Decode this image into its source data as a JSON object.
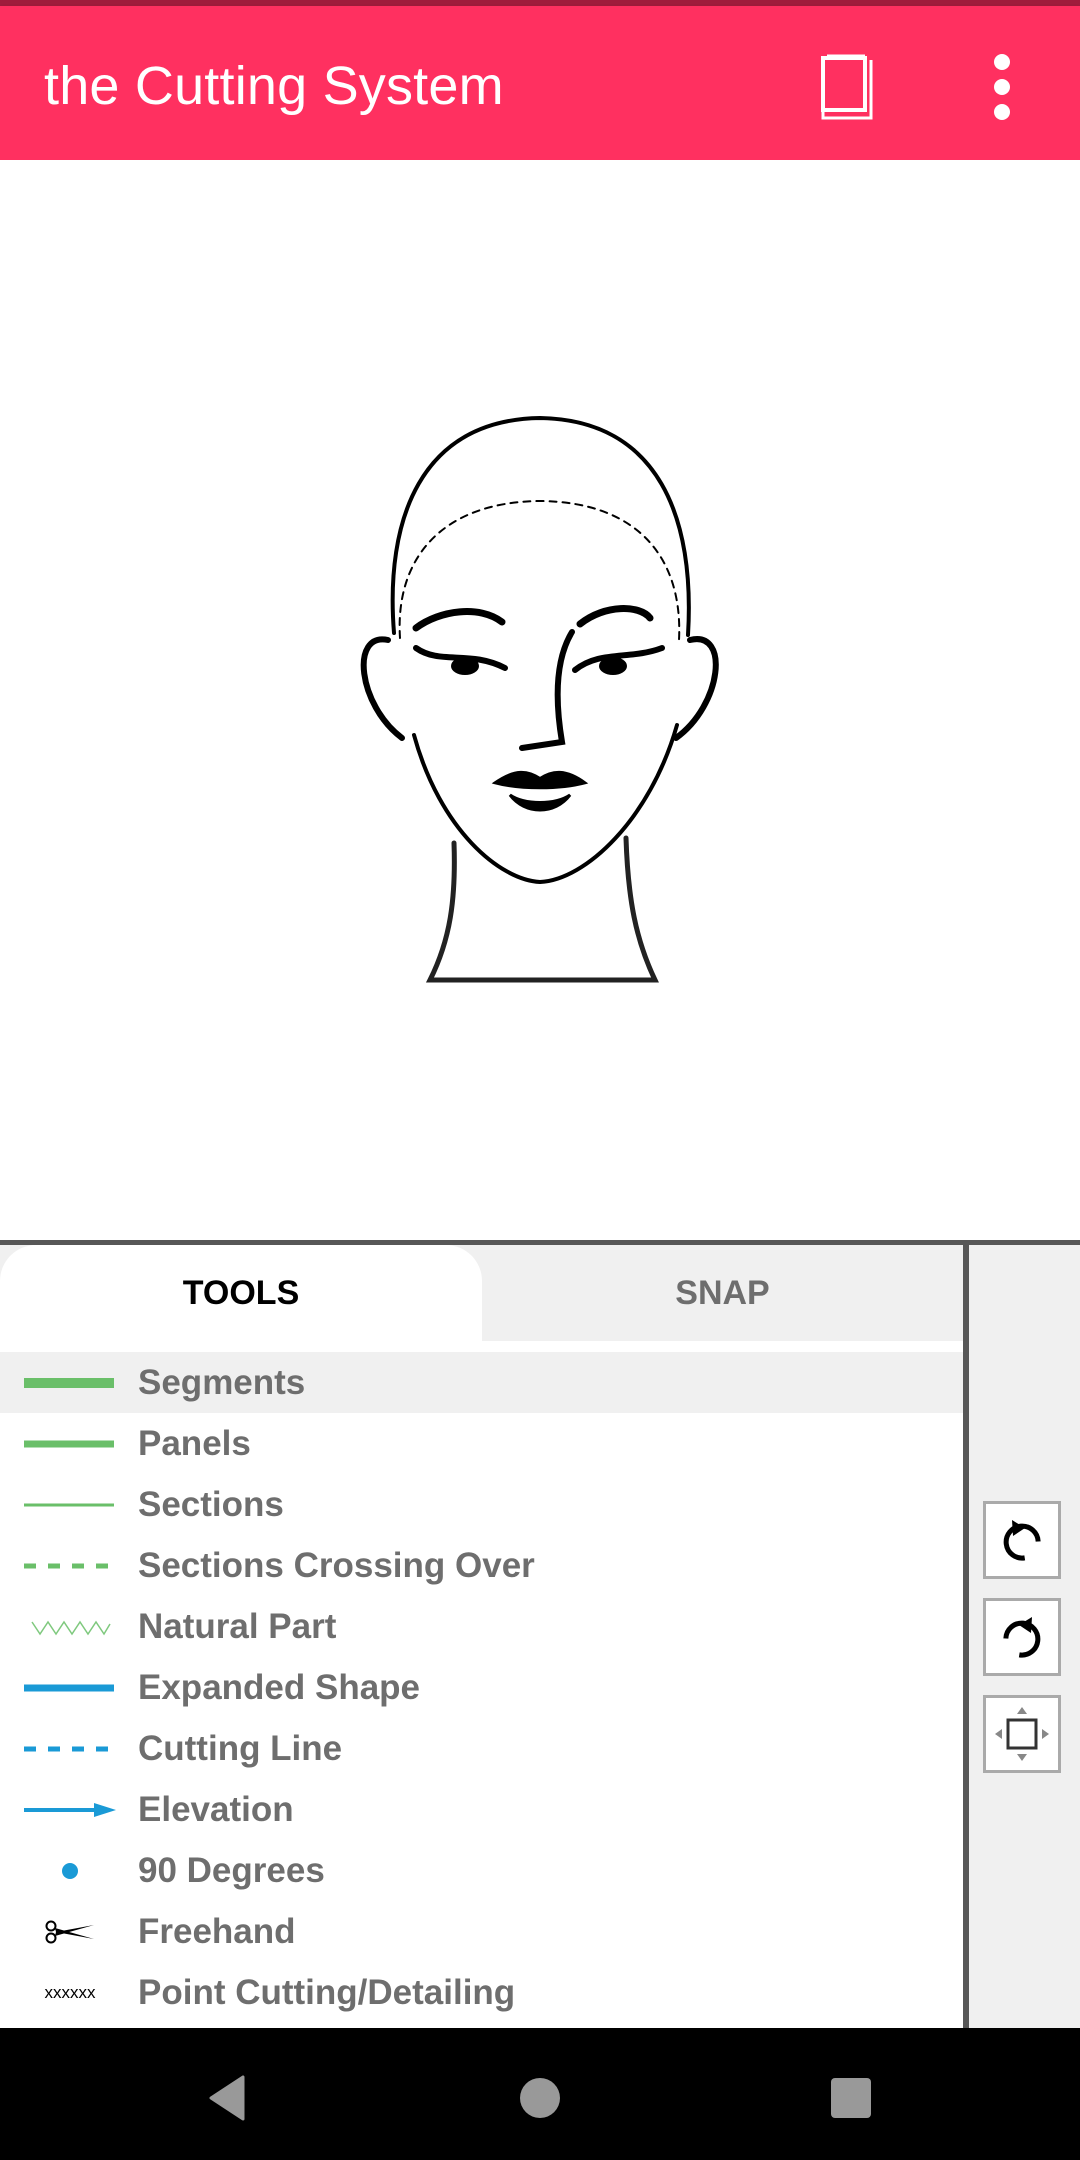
{
  "app": {
    "title": "the Cutting System",
    "actions": [
      {
        "name": "book-icon",
        "label": "Guide"
      },
      {
        "name": "more-vert-icon",
        "label": "More options"
      }
    ]
  },
  "canvas": {
    "subject": "head-outline-drawing"
  },
  "panel": {
    "tabs": [
      {
        "label": "TOOLS",
        "selected": true
      },
      {
        "label": "SNAP",
        "selected": false
      }
    ],
    "tools": [
      {
        "label": "Segments",
        "icon": "thick-green-line",
        "selected": true
      },
      {
        "label": "Panels",
        "icon": "medium-green-line",
        "selected": false
      },
      {
        "label": "Sections",
        "icon": "thin-green-line",
        "selected": false
      },
      {
        "label": "Sections Crossing Over",
        "icon": "dashed-green-line",
        "selected": false
      },
      {
        "label": "Natural Part",
        "icon": "zigzag-green-line",
        "selected": false
      },
      {
        "label": "Expanded Shape",
        "icon": "thick-blue-line",
        "selected": false
      },
      {
        "label": "Cutting Line",
        "icon": "dashed-blue-line",
        "selected": false
      },
      {
        "label": "Elevation",
        "icon": "blue-arrow",
        "selected": false
      },
      {
        "label": "90 Degrees",
        "icon": "blue-dot",
        "selected": false
      },
      {
        "label": "Freehand",
        "icon": "scissors",
        "selected": false
      },
      {
        "label": "Point Cutting/Detailing",
        "icon": "xxxxxx",
        "icon_text": "xxxxxx",
        "selected": false
      }
    ]
  },
  "side_tools": [
    {
      "name": "undo-button",
      "icon": "undo-icon"
    },
    {
      "name": "redo-button",
      "icon": "redo-icon"
    },
    {
      "name": "move-button",
      "icon": "move-icon"
    }
  ],
  "colors": {
    "appbar": "#ff3060",
    "green": "#6abf69",
    "blue": "#1a9ad6",
    "label_gray": "#6e6e6e"
  }
}
